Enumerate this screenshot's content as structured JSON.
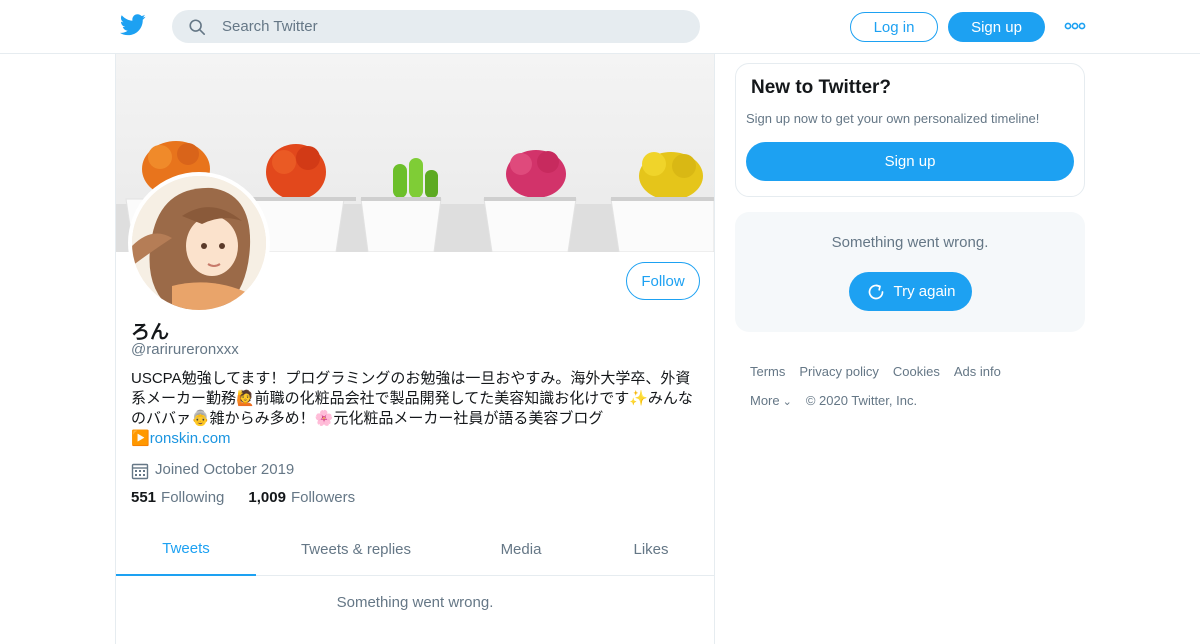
{
  "header": {
    "logo": "twitter-bird-icon",
    "search_placeholder": "Search Twitter",
    "login_label": "Log in",
    "signup_label": "Sign up",
    "more_icon": "more-dots-icon"
  },
  "profile": {
    "name": "ろん",
    "handle": "@rarirureronxxx",
    "bio_text": "USCPA勉強してます！プログラミングのお勉強は一旦おやすみ。海外大学卒、外資系メーカー勤務🙋前職の化粧品会社で製品開発してた美容知識お化けです✨みんなのババァ👵雑からみ多め！🌸元化粧品メーカー社員が語る美容ブログ",
    "bio_link_prefix": "▶️",
    "bio_link": "ronskin.com",
    "joined": "Joined October 2019",
    "following_count": "551",
    "following_label": "Following",
    "followers_count": "1,009",
    "followers_label": "Followers",
    "follow_button": "Follow"
  },
  "tabs": [
    {
      "label": "Tweets",
      "active": true
    },
    {
      "label": "Tweets & replies",
      "active": false
    },
    {
      "label": "Media",
      "active": false
    },
    {
      "label": "Likes",
      "active": false
    }
  ],
  "feed": {
    "error": "Something went wrong."
  },
  "sidebar": {
    "new_title": "New to Twitter?",
    "new_subtitle": "Sign up now to get your own personalized timeline!",
    "signup_label": "Sign up",
    "error_text": "Something went wrong.",
    "try_again_label": "Try again"
  },
  "footer": {
    "links": [
      "Terms",
      "Privacy policy",
      "Cookies",
      "Ads info"
    ],
    "more_label": "More",
    "copyright": "© 2020 Twitter, Inc."
  },
  "colors": {
    "accent": "#1da1f2",
    "text_secondary": "#657786",
    "border": "#e6ecf0"
  }
}
